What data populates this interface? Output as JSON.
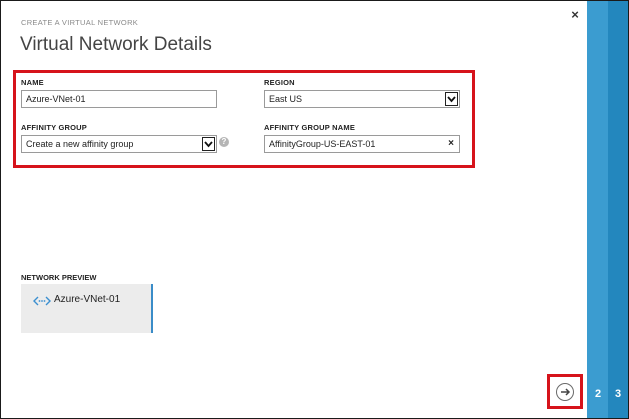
{
  "wizard": {
    "eyebrow": "CREATE A VIRTUAL NETWORK",
    "title": "Virtual Network Details"
  },
  "form": {
    "name_label": "NAME",
    "name_value": "Azure-VNet-01",
    "region_label": "REGION",
    "region_value": "East US",
    "affinity_label": "AFFINITY GROUP",
    "affinity_value": "Create a new affinity group",
    "affinity_help": "?",
    "affinity_name_label": "AFFINITY GROUP NAME",
    "affinity_name_value": "AffinityGroup-US-EAST-01",
    "clear_glyph": "×"
  },
  "preview": {
    "label": "NETWORK PREVIEW",
    "network_name": "Azure-VNet-01"
  },
  "steps": {
    "step2": "2",
    "step3": "3"
  },
  "controls": {
    "close_glyph": "×"
  },
  "colors": {
    "accent_blue": "#3b9cd0",
    "accent_blue_dark": "#2387be",
    "highlight_red": "#d6131b"
  }
}
